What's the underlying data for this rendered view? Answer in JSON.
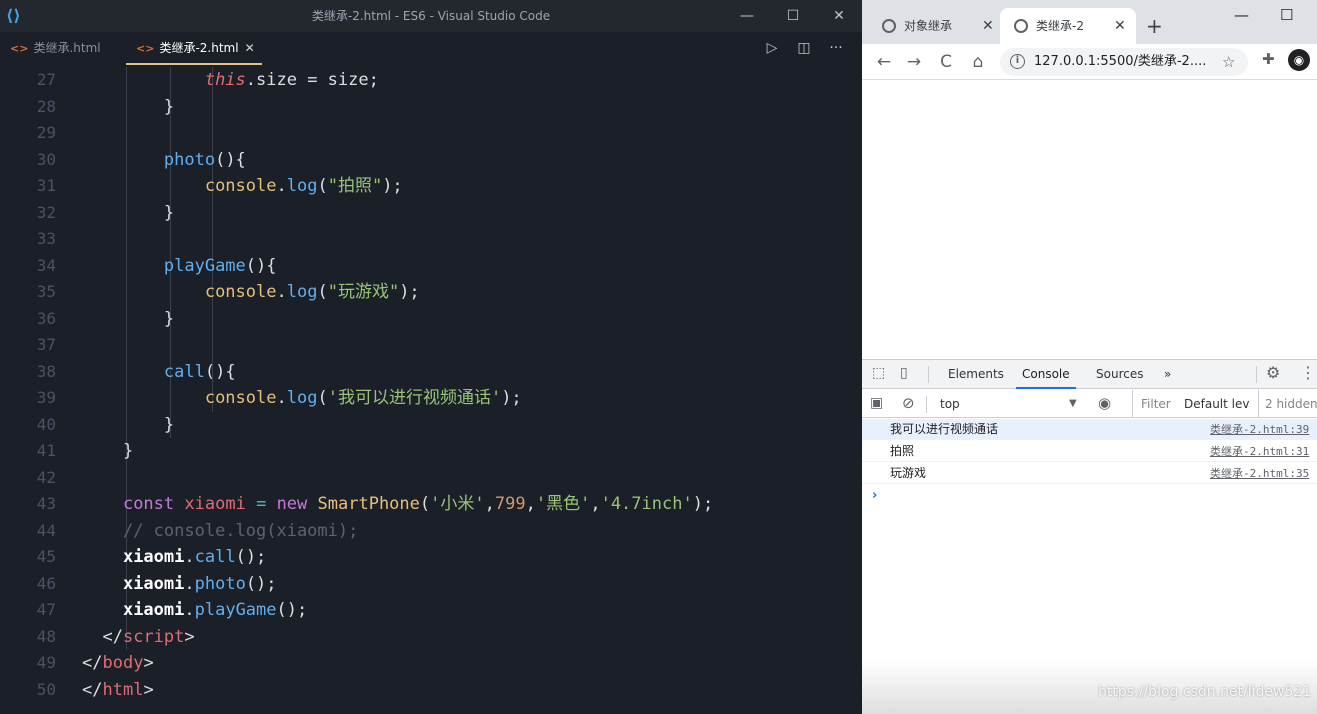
{
  "vscode": {
    "window_title": "类继承-2.html - ES6 - Visual Studio Code",
    "logo": "vscode-logo",
    "controls": {
      "minimize": "—",
      "maximize": "☐",
      "close": "✕"
    },
    "tabs": [
      {
        "label": "类继承.html",
        "active": false
      },
      {
        "label": "类继承-2.html",
        "active": true,
        "close": "✕"
      }
    ],
    "actions": {
      "run": "▷",
      "split": "◫",
      "more": "···"
    },
    "lines": [
      {
        "n": "27",
        "tokens": [
          [
            "            ",
            "t-plain"
          ],
          [
            "this",
            "t-this"
          ],
          [
            ".size = size;",
            "t-plain"
          ]
        ]
      },
      {
        "n": "28",
        "tokens": [
          [
            "        }",
            "t-plain"
          ]
        ]
      },
      {
        "n": "29",
        "tokens": []
      },
      {
        "n": "30",
        "tokens": [
          [
            "        ",
            "t-plain"
          ],
          [
            "photo",
            "t-fn"
          ],
          [
            "(){",
            "t-plain"
          ]
        ]
      },
      {
        "n": "31",
        "tokens": [
          [
            "            ",
            "t-plain"
          ],
          [
            "console",
            "t-obj"
          ],
          [
            ".",
            "t-plain"
          ],
          [
            "log",
            "t-fn"
          ],
          [
            "(",
            "t-plain"
          ],
          [
            "\"拍照\"",
            "t-str"
          ],
          [
            ");",
            "t-plain"
          ]
        ]
      },
      {
        "n": "32",
        "tokens": [
          [
            "        }",
            "t-plain"
          ]
        ]
      },
      {
        "n": "33",
        "tokens": []
      },
      {
        "n": "34",
        "tokens": [
          [
            "        ",
            "t-plain"
          ],
          [
            "playGame",
            "t-fn"
          ],
          [
            "(){",
            "t-plain"
          ]
        ]
      },
      {
        "n": "35",
        "tokens": [
          [
            "            ",
            "t-plain"
          ],
          [
            "console",
            "t-obj"
          ],
          [
            ".",
            "t-plain"
          ],
          [
            "log",
            "t-fn"
          ],
          [
            "(",
            "t-plain"
          ],
          [
            "\"玩游戏\"",
            "t-str"
          ],
          [
            ");",
            "t-plain"
          ]
        ]
      },
      {
        "n": "36",
        "tokens": [
          [
            "        }",
            "t-plain"
          ]
        ]
      },
      {
        "n": "37",
        "tokens": []
      },
      {
        "n": "38",
        "tokens": [
          [
            "        ",
            "t-plain"
          ],
          [
            "call",
            "t-fn"
          ],
          [
            "(){",
            "t-plain"
          ]
        ]
      },
      {
        "n": "39",
        "tokens": [
          [
            "            ",
            "t-plain"
          ],
          [
            "console",
            "t-obj"
          ],
          [
            ".",
            "t-plain"
          ],
          [
            "log",
            "t-fn"
          ],
          [
            "(",
            "t-plain"
          ],
          [
            "'我可以进行视频通话'",
            "t-str"
          ],
          [
            ");",
            "t-plain"
          ]
        ]
      },
      {
        "n": "40",
        "tokens": [
          [
            "        }",
            "t-plain"
          ]
        ]
      },
      {
        "n": "41",
        "tokens": [
          [
            "    }",
            "t-plain"
          ]
        ]
      },
      {
        "n": "42",
        "tokens": []
      },
      {
        "n": "43",
        "tokens": [
          [
            "    ",
            "t-plain"
          ],
          [
            "const",
            "t-kw"
          ],
          [
            " ",
            "t-plain"
          ],
          [
            "xiaomi",
            "t-var"
          ],
          [
            " ",
            "t-plain"
          ],
          [
            "=",
            "t-op"
          ],
          [
            " ",
            "t-plain"
          ],
          [
            "new",
            "t-kw"
          ],
          [
            " ",
            "t-plain"
          ],
          [
            "SmartPhone",
            "t-cls"
          ],
          [
            "(",
            "t-plain"
          ],
          [
            "'小米'",
            "t-str"
          ],
          [
            ",",
            "t-plain"
          ],
          [
            "799",
            "t-num"
          ],
          [
            ",",
            "t-plain"
          ],
          [
            "'黑色'",
            "t-str"
          ],
          [
            ",",
            "t-plain"
          ],
          [
            "'4.7inch'",
            "t-str"
          ],
          [
            ");",
            "t-plain"
          ]
        ]
      },
      {
        "n": "44",
        "tokens": [
          [
            "    ",
            "t-plain"
          ],
          [
            "// console.log(xiaomi);",
            "t-com"
          ]
        ]
      },
      {
        "n": "45",
        "tokens": [
          [
            "    ",
            "t-plain"
          ],
          [
            "xiaomi",
            "t-white"
          ],
          [
            ".",
            "t-plain"
          ],
          [
            "call",
            "t-fn"
          ],
          [
            "();",
            "t-plain"
          ]
        ]
      },
      {
        "n": "46",
        "tokens": [
          [
            "    ",
            "t-plain"
          ],
          [
            "xiaomi",
            "t-white"
          ],
          [
            ".",
            "t-plain"
          ],
          [
            "photo",
            "t-fn"
          ],
          [
            "();",
            "t-plain"
          ]
        ]
      },
      {
        "n": "47",
        "tokens": [
          [
            "    ",
            "t-plain"
          ],
          [
            "xiaomi",
            "t-white"
          ],
          [
            ".",
            "t-plain"
          ],
          [
            "playGame",
            "t-fn"
          ],
          [
            "();",
            "t-plain"
          ]
        ]
      },
      {
        "n": "48",
        "tokens": [
          [
            "  ",
            "t-plain"
          ],
          [
            "</",
            "t-plain"
          ],
          [
            "script",
            "t-tag"
          ],
          [
            ">",
            "t-plain"
          ]
        ]
      },
      {
        "n": "49",
        "tokens": [
          [
            "</",
            "t-plain"
          ],
          [
            "body",
            "t-tag"
          ],
          [
            ">",
            "t-plain"
          ]
        ]
      },
      {
        "n": "50",
        "tokens": [
          [
            "</",
            "t-plain"
          ],
          [
            "html",
            "t-tag"
          ],
          [
            ">",
            "t-plain"
          ]
        ]
      }
    ]
  },
  "browser": {
    "tabs": [
      {
        "label": "对象继承",
        "close": "✕",
        "icon": "globe-icon"
      },
      {
        "label": "类继承-2",
        "close": "✕",
        "icon": "globe-icon",
        "active": true
      }
    ],
    "new_tab": "+",
    "window_controls": {
      "minimize": "—",
      "maximize": "☐"
    },
    "nav": {
      "back": "←",
      "forward": "→",
      "reload": "C",
      "home": "⌂"
    },
    "url": "127.0.0.1:5500/类继承-2....",
    "info_icon": "i",
    "star": "☆",
    "extensions": "✚",
    "profile": "◉",
    "devtools": {
      "tabs": [
        "Elements",
        "Console",
        "Sources"
      ],
      "active_tab": "Console",
      "more_tabs": "»",
      "settings": "⚙",
      "kebab": "⋮",
      "context": "top",
      "context_arrow": "▼",
      "eye": "◉",
      "filter_placeholder": "Filter",
      "levels": "Default lev",
      "hidden": "2 hidden",
      "logs": [
        {
          "message": "我可以进行视频通话",
          "source": "类继承-2.html:39",
          "selected": true
        },
        {
          "message": "拍照",
          "source": "类继承-2.html:31",
          "selected": false
        },
        {
          "message": "玩游戏",
          "source": "类继承-2.html:35",
          "selected": false
        }
      ],
      "prompt": "›"
    },
    "watermark": "https://blog.csdn.net/lidew521"
  }
}
